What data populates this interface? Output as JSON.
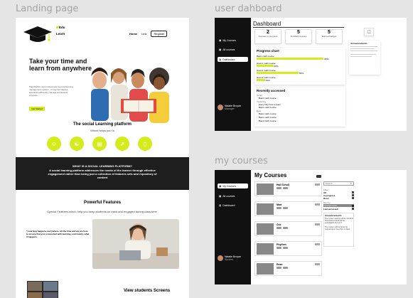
{
  "frames": {
    "landing_title": "Landing page",
    "dashboard_title": "user dahboard",
    "courses_title": "my courses"
  },
  "landing": {
    "logo": {
      "line1": "Edu",
      "line2": "Learn"
    },
    "nav": {
      "home": "Home",
      "link": "Link",
      "register": "Register"
    },
    "hero_title": "Take your time and learn from anywhere",
    "hero_text": "The Worlds most trusted open-source learning management system . it may bet helping educators efficiently manage and assess progress.",
    "hero_button": "Get Started",
    "platform_title": "The social Learning platform",
    "platform_sub": "Which helps you to",
    "band_question": "WHAT IS A SOCIAL LEARNING PLATFORM?",
    "band_text": "A social learning platform addresses the needs of the learner through effective engagement rather than being just a collection of features sets and repository of content",
    "powerful_title": "Powerful Features",
    "powerful_sub": "Special Features which help you keep students on track and engaged during class time.",
    "quote": "\" Learning happens everywhere. All the time and we are here to ensure that your connected with learning, community, what it happens.",
    "view_students": "View students Screens"
  },
  "dashboard": {
    "title": "Dashboard",
    "stats": [
      {
        "number": "2",
        "label": "Courses in progress"
      },
      {
        "number": "5",
        "label": "Finished courses"
      },
      {
        "number": "5",
        "label": "Earned badges"
      }
    ],
    "progress_title": "Progress chart",
    "progress": [
      {
        "name": "Basic math course",
        "percent": 80,
        "label": "80%"
      },
      {
        "name": "How to math course",
        "percent": 20,
        "label": "20%"
      },
      {
        "name": "How to math course",
        "percent": 50,
        "label": "50%"
      },
      {
        "name": "How to math course",
        "percent": 10,
        "label": "10%"
      }
    ],
    "recent_title": "Recently accessed",
    "recent_today": "Today",
    "recent_yesterday": "Yesterday",
    "recent_older": "Date",
    "recent_items": [
      "Basic math course",
      "Every Day how to learn",
      "Basic math course",
      "Basic math course",
      "Basic math course",
      "Basic math course"
    ],
    "announcements_title": "Announcements",
    "menu": {
      "my_courses": "My Courses",
      "all_courses": "All courses",
      "dashboard": "Dashboard"
    },
    "user": {
      "name": "Natalie Broyan",
      "role": "Manager"
    }
  },
  "courses": {
    "title": "My Courses",
    "menu": {
      "my_courses": "My Courses",
      "all_courses": "All courses",
      "dashboard": "Dashboard"
    },
    "user": {
      "name": "Natalie Broyan",
      "role": "Student"
    },
    "list": [
      "Hail Schull",
      "Mart",
      "Css",
      "Phythen",
      "Rean"
    ],
    "search_placeholder": "Search",
    "filter_title": "Filter",
    "filters": [
      "All",
      "In progress",
      "Done"
    ],
    "sort_title": "Sort by",
    "sorts": [
      "Course name",
      "Last accessed"
    ],
    "announcements_title": "Announcements",
    "announcement_text": "The system testing will be active in this weekend and will be unavailable for 9 to 5",
    "announcement_text2": "The system will be down for maintenance from 8pm to 8am"
  }
}
